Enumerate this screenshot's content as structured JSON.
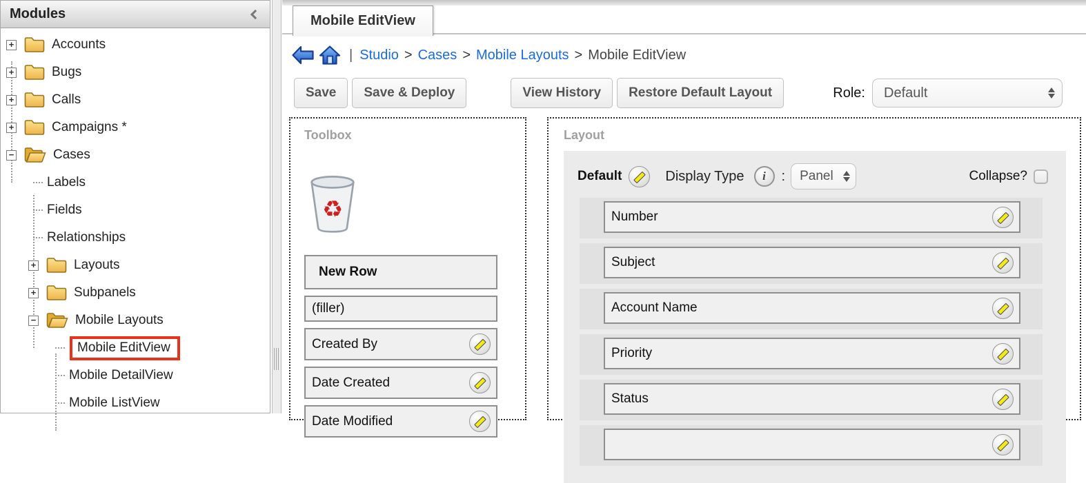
{
  "sidebar": {
    "title": "Modules",
    "items": [
      {
        "label": "Accounts",
        "expander": "+"
      },
      {
        "label": "Bugs",
        "expander": "+"
      },
      {
        "label": "Calls",
        "expander": "+"
      },
      {
        "label": "Campaigns *",
        "expander": "+"
      },
      {
        "label": "Cases",
        "expander": "−"
      },
      {
        "label": "Labels"
      },
      {
        "label": "Fields"
      },
      {
        "label": "Relationships"
      },
      {
        "label": "Layouts",
        "expander": "+"
      },
      {
        "label": "Subpanels",
        "expander": "+"
      },
      {
        "label": "Mobile Layouts",
        "expander": "−"
      },
      {
        "label": "Mobile EditView",
        "highlighted": true
      },
      {
        "label": "Mobile DetailView"
      },
      {
        "label": "Mobile ListView"
      }
    ]
  },
  "tab": {
    "title": "Mobile EditView"
  },
  "breadcrumb": {
    "pipe": "|",
    "sep": ">",
    "links": [
      "Studio",
      "Cases",
      "Mobile Layouts"
    ],
    "current": "Mobile EditView"
  },
  "toolbar": {
    "save_label": "Save",
    "save_deploy_label": "Save & Deploy",
    "view_history_label": "View History",
    "restore_label": "Restore Default Layout",
    "role_label": "Role:",
    "role_value": "Default"
  },
  "toolbox": {
    "title": "Toolbox",
    "items": [
      {
        "label": "New Row"
      },
      {
        "label": "(filler)"
      },
      {
        "label": "Created By"
      },
      {
        "label": "Date Created"
      },
      {
        "label": "Date Modified"
      }
    ]
  },
  "layout": {
    "title": "Layout",
    "panel_name": "Default",
    "display_type_label": "Display Type",
    "colon": ":",
    "display_type_value": "Panel",
    "collapse_label": "Collapse?",
    "fields": [
      "Number",
      "Subject",
      "Account Name",
      "Priority",
      "Status"
    ]
  },
  "colors": {
    "accent_blue": "#1a6bdc",
    "highlight_red": "#e8321b",
    "folder_gold": "#f2bc43"
  }
}
